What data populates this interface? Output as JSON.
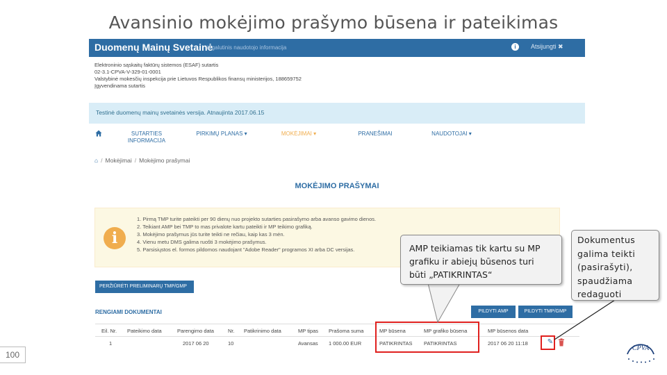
{
  "slide": {
    "title": "Avansinio mokėjimo prašymo būsena ir pateikimas",
    "page_number": "100"
  },
  "app": {
    "site_title": "Duomenų Mainų Svetainė",
    "site_subtitle": "ir galutinis naudotojo informacija",
    "logout_label": "Atsijungti",
    "org_lines": [
      "Elektroninio sąskaitų faktūrų sistemos (ESAF) sutartis",
      "02-3.1-CPVA-V-329-01-0001",
      "Valstybinė mokesčių inspekcija prie Lietuvos Respublikos finansų ministerijos, 188659752",
      "Įgyvendinama sutartis"
    ],
    "test_banner": "Testinė duomenų mainų svetainės versija. Atnaujinta 2017.06.15",
    "nav": [
      {
        "label_1": "SUTARTIES",
        "label_2": "INFORMACIJA"
      },
      {
        "label_1": "PIRKIMŲ PLANAS ▾",
        "label_2": ""
      },
      {
        "label_1": "MOKĖJIMAI ▾",
        "label_2": ""
      },
      {
        "label_1": "PRANEŠIMAI",
        "label_2": ""
      },
      {
        "label_1": "NAUDOTOJAI ▾",
        "label_2": ""
      }
    ],
    "breadcrumb": [
      "Mokėjimai",
      "Mokėjimo prašymai"
    ],
    "page_heading": "MOKĖJIMO PRAŠYMAI",
    "warning_items": [
      "1. Pirmą TMP turite pateikti per 90 dienų nuo projekto sutarties pasirašymo arba avanso gavimo dienos.",
      "2. Teikiant AMP bei TMP to mas privalote kartu pateikti ir MP teikimo grafiką.",
      "3. Mokėjimo prašymus jūs turite teikti ne rečiau, kaip kas 3 mėn.",
      "4. Vienu metu DMS galima ruošti 3 mokėjimo prašymus.",
      "5. Parsisiųstos el. formos pildomos naudojant \"Adobe Reader\" programos XI arba DC versijas."
    ],
    "btn_prelim": "PERŽIŪRĖTI PRELIMINARŲ TMP/GMP",
    "docs_heading": "RENGIAMI DOKUMENTAI",
    "btn_amp": "PILDYTI AMP",
    "btn_tmp": "PILDYTI TMP/GMP",
    "table": {
      "headers": [
        "Eil. Nr.",
        "Pateikimo data",
        "Parengimo data",
        "Nr.",
        "Patikrinimo data",
        "MP tipas",
        "Prašoma suma",
        "MP būsena",
        "MP grafiko būsena",
        "MP būsenos data"
      ],
      "rows": [
        [
          "1",
          "",
          "2017 06 20",
          "10",
          "",
          "Avansas",
          "1 000.00 EUR",
          "PATIKRINTAS",
          "PATIKRINTAS",
          "2017 06 20 11:18"
        ]
      ]
    }
  },
  "callouts": {
    "amp": [
      "AMP teikiamas tik kartu su MP",
      "grafiku ir abiejų būsenos turi",
      "būti „PATIKRINTAS“"
    ],
    "doc": [
      "Dokumentus",
      "galima teikti",
      "(pasirašyti),",
      "spaudžiama",
      "redaguoti"
    ]
  },
  "logo": {
    "text": "CPVA"
  },
  "colors": {
    "primary": "#2e6da4",
    "active_nav": "#f0ad4e",
    "highlight": "#e0201e",
    "warning_bg": "#fcf8e3",
    "info_bg": "#d9edf7"
  },
  "icons": [
    "home-icon",
    "info-icon",
    "close-icon",
    "info-circle-icon",
    "edit-icon",
    "trash-icon"
  ]
}
